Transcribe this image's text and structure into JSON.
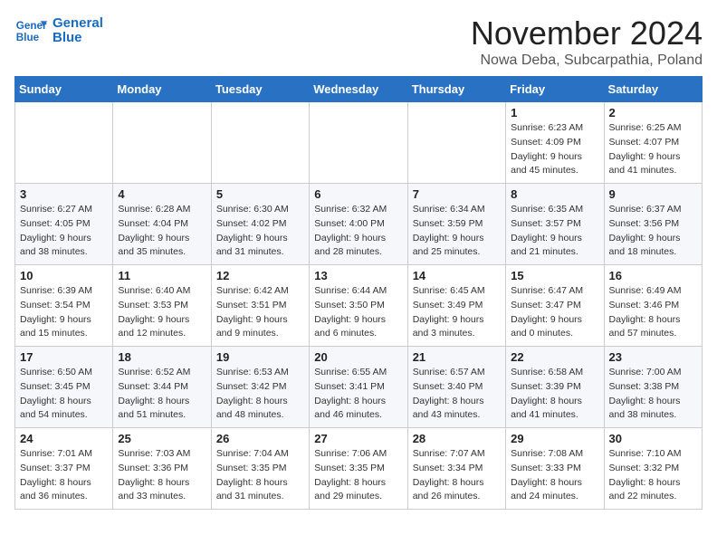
{
  "logo": {
    "line1": "General",
    "line2": "Blue"
  },
  "title": "November 2024",
  "subtitle": "Nowa Deba, Subcarpathia, Poland",
  "days_of_week": [
    "Sunday",
    "Monday",
    "Tuesday",
    "Wednesday",
    "Thursday",
    "Friday",
    "Saturday"
  ],
  "weeks": [
    [
      {
        "day": "",
        "info": ""
      },
      {
        "day": "",
        "info": ""
      },
      {
        "day": "",
        "info": ""
      },
      {
        "day": "",
        "info": ""
      },
      {
        "day": "",
        "info": ""
      },
      {
        "day": "1",
        "info": "Sunrise: 6:23 AM\nSunset: 4:09 PM\nDaylight: 9 hours and 45 minutes."
      },
      {
        "day": "2",
        "info": "Sunrise: 6:25 AM\nSunset: 4:07 PM\nDaylight: 9 hours and 41 minutes."
      }
    ],
    [
      {
        "day": "3",
        "info": "Sunrise: 6:27 AM\nSunset: 4:05 PM\nDaylight: 9 hours and 38 minutes."
      },
      {
        "day": "4",
        "info": "Sunrise: 6:28 AM\nSunset: 4:04 PM\nDaylight: 9 hours and 35 minutes."
      },
      {
        "day": "5",
        "info": "Sunrise: 6:30 AM\nSunset: 4:02 PM\nDaylight: 9 hours and 31 minutes."
      },
      {
        "day": "6",
        "info": "Sunrise: 6:32 AM\nSunset: 4:00 PM\nDaylight: 9 hours and 28 minutes."
      },
      {
        "day": "7",
        "info": "Sunrise: 6:34 AM\nSunset: 3:59 PM\nDaylight: 9 hours and 25 minutes."
      },
      {
        "day": "8",
        "info": "Sunrise: 6:35 AM\nSunset: 3:57 PM\nDaylight: 9 hours and 21 minutes."
      },
      {
        "day": "9",
        "info": "Sunrise: 6:37 AM\nSunset: 3:56 PM\nDaylight: 9 hours and 18 minutes."
      }
    ],
    [
      {
        "day": "10",
        "info": "Sunrise: 6:39 AM\nSunset: 3:54 PM\nDaylight: 9 hours and 15 minutes."
      },
      {
        "day": "11",
        "info": "Sunrise: 6:40 AM\nSunset: 3:53 PM\nDaylight: 9 hours and 12 minutes."
      },
      {
        "day": "12",
        "info": "Sunrise: 6:42 AM\nSunset: 3:51 PM\nDaylight: 9 hours and 9 minutes."
      },
      {
        "day": "13",
        "info": "Sunrise: 6:44 AM\nSunset: 3:50 PM\nDaylight: 9 hours and 6 minutes."
      },
      {
        "day": "14",
        "info": "Sunrise: 6:45 AM\nSunset: 3:49 PM\nDaylight: 9 hours and 3 minutes."
      },
      {
        "day": "15",
        "info": "Sunrise: 6:47 AM\nSunset: 3:47 PM\nDaylight: 9 hours and 0 minutes."
      },
      {
        "day": "16",
        "info": "Sunrise: 6:49 AM\nSunset: 3:46 PM\nDaylight: 8 hours and 57 minutes."
      }
    ],
    [
      {
        "day": "17",
        "info": "Sunrise: 6:50 AM\nSunset: 3:45 PM\nDaylight: 8 hours and 54 minutes."
      },
      {
        "day": "18",
        "info": "Sunrise: 6:52 AM\nSunset: 3:44 PM\nDaylight: 8 hours and 51 minutes."
      },
      {
        "day": "19",
        "info": "Sunrise: 6:53 AM\nSunset: 3:42 PM\nDaylight: 8 hours and 48 minutes."
      },
      {
        "day": "20",
        "info": "Sunrise: 6:55 AM\nSunset: 3:41 PM\nDaylight: 8 hours and 46 minutes."
      },
      {
        "day": "21",
        "info": "Sunrise: 6:57 AM\nSunset: 3:40 PM\nDaylight: 8 hours and 43 minutes."
      },
      {
        "day": "22",
        "info": "Sunrise: 6:58 AM\nSunset: 3:39 PM\nDaylight: 8 hours and 41 minutes."
      },
      {
        "day": "23",
        "info": "Sunrise: 7:00 AM\nSunset: 3:38 PM\nDaylight: 8 hours and 38 minutes."
      }
    ],
    [
      {
        "day": "24",
        "info": "Sunrise: 7:01 AM\nSunset: 3:37 PM\nDaylight: 8 hours and 36 minutes."
      },
      {
        "day": "25",
        "info": "Sunrise: 7:03 AM\nSunset: 3:36 PM\nDaylight: 8 hours and 33 minutes."
      },
      {
        "day": "26",
        "info": "Sunrise: 7:04 AM\nSunset: 3:35 PM\nDaylight: 8 hours and 31 minutes."
      },
      {
        "day": "27",
        "info": "Sunrise: 7:06 AM\nSunset: 3:35 PM\nDaylight: 8 hours and 29 minutes."
      },
      {
        "day": "28",
        "info": "Sunrise: 7:07 AM\nSunset: 3:34 PM\nDaylight: 8 hours and 26 minutes."
      },
      {
        "day": "29",
        "info": "Sunrise: 7:08 AM\nSunset: 3:33 PM\nDaylight: 8 hours and 24 minutes."
      },
      {
        "day": "30",
        "info": "Sunrise: 7:10 AM\nSunset: 3:32 PM\nDaylight: 8 hours and 22 minutes."
      }
    ]
  ]
}
